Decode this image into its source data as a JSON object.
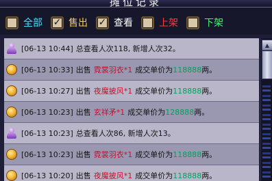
{
  "window": {
    "title": "摊位记录"
  },
  "filters": [
    {
      "label": "全部",
      "checked": false,
      "color": "#3ee0ff"
    },
    {
      "label": "售出",
      "checked": true,
      "color": "#ffd23a"
    },
    {
      "label": "查看",
      "checked": true,
      "color": "#ffffff"
    },
    {
      "label": "上架",
      "checked": false,
      "color": "#ff3a3a"
    },
    {
      "label": "下架",
      "checked": false,
      "color": "#3aff6a"
    }
  ],
  "records": [
    {
      "icon": "person-icon",
      "time": "[06-13 10:44]",
      "text": "总查看人次118, 新增人次32。"
    },
    {
      "icon": "coin-icon",
      "time": "[06-13 10:33]",
      "action": "出售",
      "item": "霓裳羽衣*1",
      "mid": "成交单价为",
      "price": "118888",
      "unit": "两。"
    },
    {
      "icon": "coin-icon",
      "time": "[06-13 10:27]",
      "action": "出售",
      "item": "夜魔披风*1",
      "mid": "成交单价为",
      "price": "118888",
      "unit": "两。"
    },
    {
      "icon": "coin-icon",
      "time": "[06-13 10:23]",
      "action": "出售",
      "item": "玄祥矛*1",
      "mid": "成交单价为",
      "price": "128888",
      "unit": "两。"
    },
    {
      "icon": "person-icon",
      "time": "[06-13 10:23]",
      "text": "总查看人次86, 新增人次13。"
    },
    {
      "icon": "coin-icon",
      "time": "[06-13 10:23]",
      "action": "出售",
      "item": "霓裳羽衣*1",
      "mid": "成交单价为",
      "price": "118888",
      "unit": "两。"
    },
    {
      "icon": "coin-icon",
      "time": "[06-13 10:20]",
      "action": "出售",
      "item": "夜魔披风*1",
      "mid": "成交单价为",
      "price": "118888",
      "unit": "两。"
    }
  ]
}
